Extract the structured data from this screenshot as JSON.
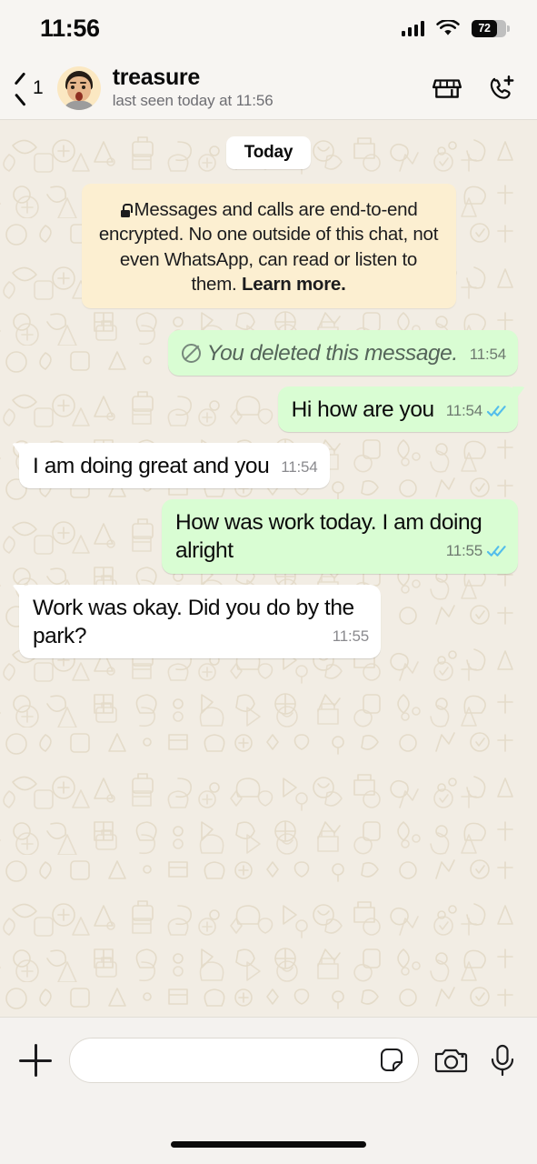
{
  "status_bar": {
    "time": "11:56",
    "signal_icon": "cellular-bars-icon",
    "wifi_icon": "wifi-icon",
    "battery_percent": "72"
  },
  "header": {
    "back_icon": "back-chevron-icon",
    "unread_count": "1",
    "avatar_icon": "contact-avatar",
    "contact_name": "treasure",
    "contact_status": "last seen today at 11:56",
    "shop_icon": "storefront-icon",
    "add_call_icon": "phone-plus-icon"
  },
  "chat": {
    "day_divider": "Today",
    "encryption_notice": {
      "lock_icon": "lock-icon",
      "text": "Messages and calls are end-to-end encrypted. No one outside of this chat, not even WhatsApp, can read or listen to them.",
      "link_label": "Learn more."
    },
    "messages": [
      {
        "direction": "out",
        "style": "deleted",
        "icon": "blocked-circle-icon",
        "text": "You deleted this message.",
        "time": "11:54",
        "receipt": "none",
        "tail": "none",
        "multiline": false
      },
      {
        "direction": "out",
        "style": "normal",
        "text": "Hi how are you",
        "time": "11:54",
        "receipt": "read-double-check-icon",
        "tail": "right",
        "multiline": false
      },
      {
        "direction": "in",
        "style": "normal",
        "text": "I am doing great and you",
        "time": "11:54",
        "receipt": "none",
        "tail": "left",
        "multiline": false
      },
      {
        "direction": "out",
        "style": "normal",
        "text": "How was work today. I am doing alright",
        "time": "11:55",
        "receipt": "read-double-check-icon",
        "tail": "none",
        "multiline": true
      },
      {
        "direction": "in",
        "style": "normal",
        "text": "Work was okay. Did you do by the park?",
        "time": "11:55",
        "receipt": "none",
        "tail": "left",
        "multiline": true
      }
    ]
  },
  "input_bar": {
    "attach_icon": "plus-icon",
    "message_value": "",
    "message_placeholder": "",
    "sticker_icon": "sticker-icon",
    "camera_icon": "camera-icon",
    "mic_icon": "microphone-icon"
  },
  "colors": {
    "outgoing_bubble": "#D9FDD3",
    "incoming_bubble": "#FFFFFF",
    "wallpaper": "#F2EDE4",
    "encryption_banner": "#FCEFD1",
    "read_receipt": "#53BDEB",
    "chrome": "#F7F5F2"
  }
}
